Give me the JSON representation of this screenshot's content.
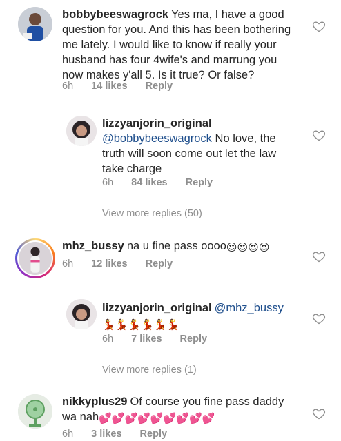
{
  "comments": [
    {
      "username": "bobbybeeswagrock",
      "text": "Yes ma, I have a good question for you. And this has been bothering me lately. I would like to know if really your husband has four 4wife's and marrung you now makes y'all 5. Is it true? Or false?",
      "time": "6h",
      "likes": "14 likes",
      "reply": "Reply"
    },
    {
      "username": "lizzyanjorin_original",
      "mention": "@bobbybeeswagrock",
      "text": "No love, the truth will soon come out let the law take charge",
      "time": "6h",
      "likes": "84 likes",
      "reply": "Reply"
    },
    {
      "view_more": "View more replies (50)"
    },
    {
      "username": "mhz_bussy",
      "text": "na u fine pass oooo",
      "emojis": "😍😍😍😍",
      "time": "6h",
      "likes": "12 likes",
      "reply": "Reply"
    },
    {
      "username": "lizzyanjorin_original",
      "mention": "@mhz_bussy",
      "emojis": "💃💃💃💃💃💃",
      "time": "6h",
      "likes": "7 likes",
      "reply": "Reply"
    },
    {
      "view_more": "View more replies (1)"
    },
    {
      "username": "nikkyplus29",
      "text": "Of course you fine pass daddy wa nah",
      "emojis": "💕💕💕💕💕💕💕💕💕",
      "time": "6h",
      "likes": "3 likes",
      "reply": "Reply"
    }
  ],
  "icons": {
    "like": "heart-outline-icon"
  },
  "colors": {
    "text": "#262626",
    "meta": "#8e8e8e",
    "mention": "#1e4e8c"
  }
}
